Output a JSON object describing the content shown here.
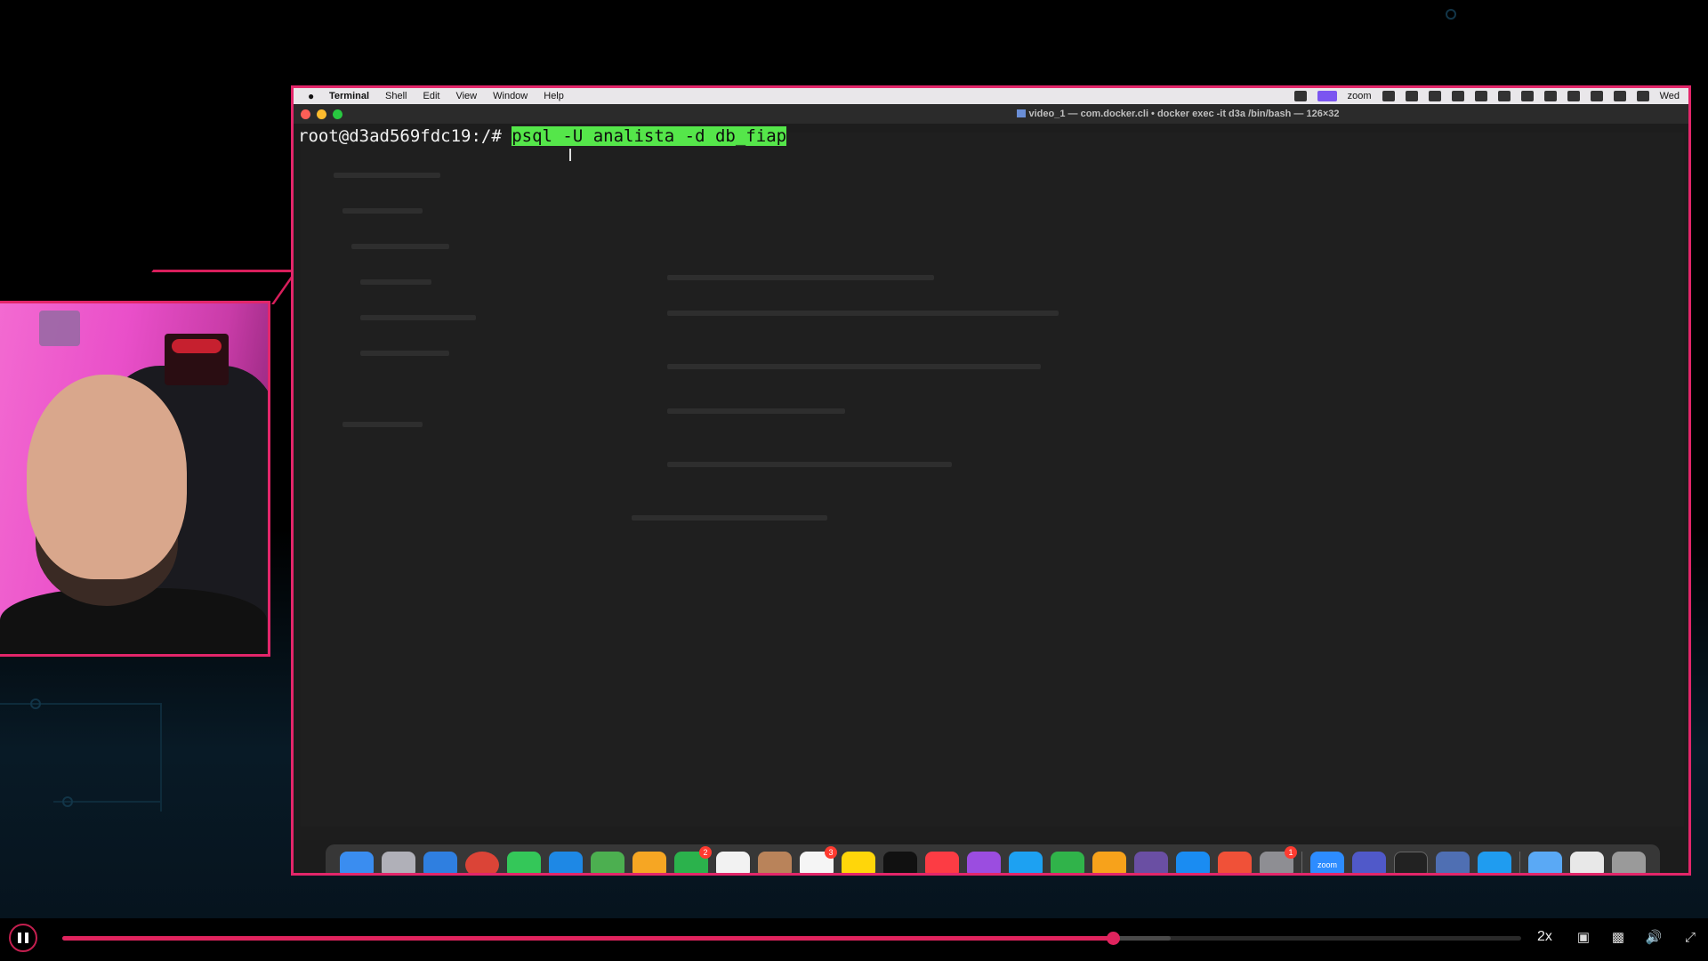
{
  "menubar": {
    "app": "Terminal",
    "items": [
      "Shell",
      "Edit",
      "View",
      "Window",
      "Help"
    ],
    "zoom_label": "zoom",
    "clock": "Wed"
  },
  "window": {
    "title": "video_1 — com.docker.cli • docker exec -it d3a /bin/bash — 126×32"
  },
  "terminal": {
    "prompt": "root@d3ad569fdc19:/# ",
    "command": "psql -U analista -d db_fiap"
  },
  "dock": {
    "badges": {
      "messages": "2",
      "calendar": "3",
      "settings": "1"
    },
    "zoom_label": "zoom"
  },
  "player": {
    "progress": 0.72,
    "buffered": 0.76,
    "speed": "2x",
    "colors": {
      "accent": "#e0245e",
      "frame": "#e3266a",
      "command_highlight": "#55e64a"
    }
  }
}
